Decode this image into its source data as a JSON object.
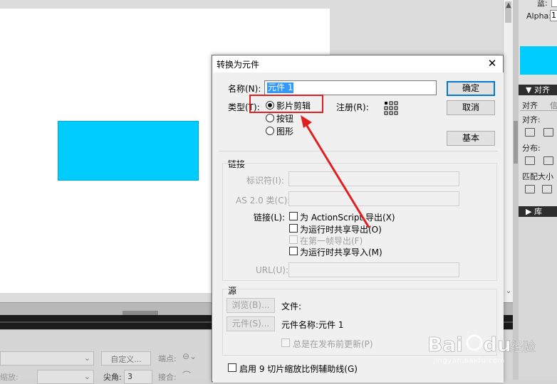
{
  "dialog": {
    "title": "转换为元件",
    "name_label": "名称(N):",
    "name_value": "元件 1",
    "type_label": "类型(T):",
    "type_options": [
      "影片剪辑",
      "按钮",
      "图形"
    ],
    "type_selected": "影片剪辑",
    "registration_label": "注册(R):",
    "ok_label": "确定",
    "cancel_label": "取消",
    "basic_label": "基本",
    "linkage": {
      "section_label": "链接",
      "identifier_label": "标识符(I):",
      "as2_class_label": "AS 2.0 类(C):",
      "linkage_label": "链接(L):",
      "options": [
        {
          "label": "为 ActionScript 导出(X)",
          "checked": false,
          "enabled": true
        },
        {
          "label": "为运行时共享导出(O)",
          "checked": false,
          "enabled": true
        },
        {
          "label": "在第一帧导出(F)",
          "checked": false,
          "enabled": false
        },
        {
          "label": "为运行时共享导入(M)",
          "checked": false,
          "enabled": true
        }
      ],
      "url_label": "URL(U):"
    },
    "source": {
      "section_label": "源",
      "browse_label": "浏览(B)...",
      "file_label": "文件:",
      "symbol_button_label": "元件(S)...",
      "symbol_name_label": "元件名称:元件 1",
      "always_update_label": "总是在发布前更新(P)"
    },
    "nine_slice_label": "启用 9 切片缩放比例辅助线(G)"
  },
  "right_panel": {
    "partial_top": "蓝:",
    "alpha_label": "Alpha:",
    "alpha_value": "1",
    "align_header": "▼ 对齐",
    "tabs": [
      "对齐",
      "信"
    ],
    "align_label": "对齐:",
    "distribute_label": "分布:",
    "match_size_label": "匹配大小",
    "library_header": "▶ 库"
  },
  "properties": {
    "custom_button": "自定义...",
    "endpoint_label": "端点:",
    "scale_label": "缩放:",
    "miter_label": "尖角:",
    "miter_value": "3",
    "join_label": "接合:"
  },
  "colors": {
    "shape_fill": "#00ccff",
    "annotation_red": "#e02020",
    "selection_blue": "#3399ff"
  },
  "watermark": {
    "logo_text": "Baidu 经验",
    "url": "jingyan.baidu.com"
  }
}
